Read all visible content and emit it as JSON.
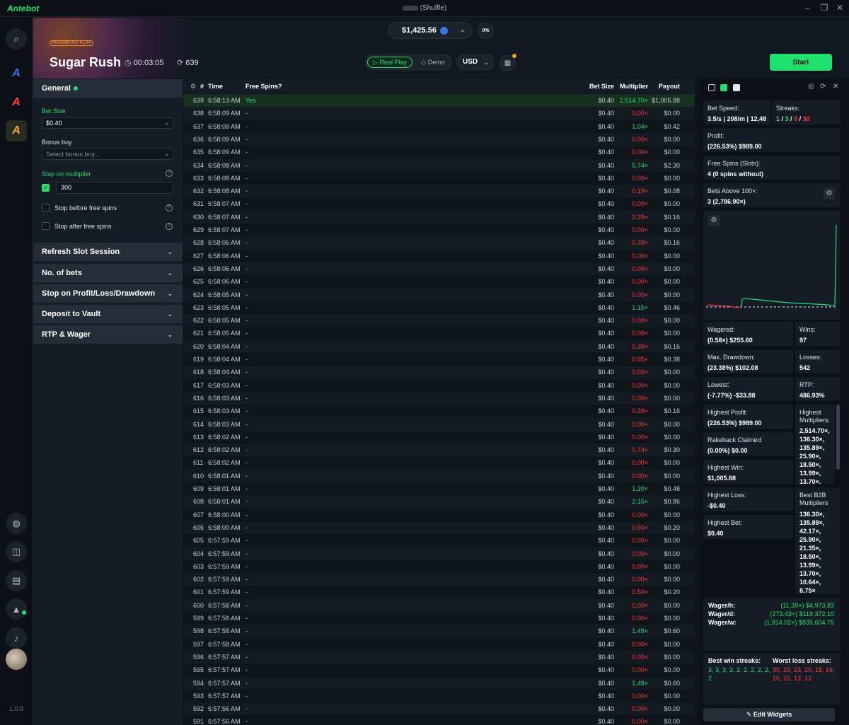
{
  "window": {
    "app": "Antebot",
    "title": "(Shuffle)"
  },
  "nav": {
    "version": "1.0.9"
  },
  "header": {
    "provider": "PRAGMATIC PLAY",
    "game": "Sugar Rush",
    "timer": "00:03:05",
    "spins": "639",
    "balance": "$1,425.56",
    "percent": "0%",
    "real_play": "Real Play",
    "demo": "Demo",
    "currency": "USD",
    "start": "Start"
  },
  "settings": {
    "general": "General",
    "bet_size_label": "Bet Size",
    "bet_size_value": "$0.40",
    "bonus_buy_label": "Bonus buy",
    "bonus_buy_placeholder": "Select bonus buy...",
    "stop_multiplier_label": "Stop on multiplier",
    "stop_multiplier_value": "300",
    "stop_before_free": "Stop before free spins",
    "stop_after_free": "Stop after free spins",
    "sections": [
      "Refresh Slot Session",
      "No. of bets",
      "Stop on Profit/Loss/Drawdown",
      "Deposit to Vault",
      "RTP & Wager"
    ]
  },
  "table": {
    "headers": {
      "id": "#",
      "time": "Time",
      "free_spins": "Free Spins?",
      "bet": "Bet Size",
      "mult": "Multiplier",
      "payout": "Payout"
    },
    "rows": [
      [
        "639",
        "6:58:13 AM",
        "Yes",
        "$0.40",
        "2,514.70×",
        "$1,005.88"
      ],
      [
        "638",
        "6:58:09 AM",
        "-",
        "$0.40",
        "0.00×",
        "$0.00"
      ],
      [
        "637",
        "6:58:09 AM",
        "-",
        "$0.40",
        "1.04×",
        "$0.42"
      ],
      [
        "636",
        "6:58:09 AM",
        "-",
        "$0.40",
        "0.00×",
        "$0.00"
      ],
      [
        "635",
        "6:58:09 AM",
        "-",
        "$0.40",
        "0.00×",
        "$0.00"
      ],
      [
        "634",
        "6:58:08 AM",
        "-",
        "$0.40",
        "5.74×",
        "$2.30"
      ],
      [
        "633",
        "6:58:08 AM",
        "-",
        "$0.40",
        "0.00×",
        "$0.00"
      ],
      [
        "632",
        "6:58:08 AM",
        "-",
        "$0.40",
        "0.19×",
        "$0.08"
      ],
      [
        "631",
        "6:58:07 AM",
        "-",
        "$0.40",
        "0.00×",
        "$0.00"
      ],
      [
        "630",
        "6:58:07 AM",
        "-",
        "$0.40",
        "0.39×",
        "$0.16"
      ],
      [
        "629",
        "6:58:07 AM",
        "-",
        "$0.40",
        "0.00×",
        "$0.00"
      ],
      [
        "628",
        "6:58:06 AM",
        "-",
        "$0.40",
        "0.39×",
        "$0.16"
      ],
      [
        "627",
        "6:58:06 AM",
        "-",
        "$0.40",
        "0.00×",
        "$0.00"
      ],
      [
        "626",
        "6:58:06 AM",
        "-",
        "$0.40",
        "0.00×",
        "$0.00"
      ],
      [
        "625",
        "6:58:06 AM",
        "-",
        "$0.40",
        "0.00×",
        "$0.00"
      ],
      [
        "624",
        "6:58:05 AM",
        "-",
        "$0.40",
        "0.00×",
        "$0.00"
      ],
      [
        "623",
        "6:58:05 AM",
        "-",
        "$0.40",
        "1.15×",
        "$0.46"
      ],
      [
        "622",
        "6:58:05 AM",
        "-",
        "$0.40",
        "0.00×",
        "$0.00"
      ],
      [
        "621",
        "6:58:05 AM",
        "-",
        "$0.40",
        "0.00×",
        "$0.00"
      ],
      [
        "620",
        "6:58:04 AM",
        "-",
        "$0.40",
        "0.39×",
        "$0.16"
      ],
      [
        "619",
        "6:58:04 AM",
        "-",
        "$0.40",
        "0.95×",
        "$0.38"
      ],
      [
        "618",
        "6:58:04 AM",
        "-",
        "$0.40",
        "0.00×",
        "$0.00"
      ],
      [
        "617",
        "6:58:03 AM",
        "-",
        "$0.40",
        "0.00×",
        "$0.00"
      ],
      [
        "616",
        "6:58:03 AM",
        "-",
        "$0.40",
        "0.00×",
        "$0.00"
      ],
      [
        "615",
        "6:58:03 AM",
        "-",
        "$0.40",
        "0.39×",
        "$0.16"
      ],
      [
        "614",
        "6:58:03 AM",
        "-",
        "$0.40",
        "0.00×",
        "$0.00"
      ],
      [
        "613",
        "6:58:02 AM",
        "-",
        "$0.40",
        "0.00×",
        "$0.00"
      ],
      [
        "612",
        "6:58:02 AM",
        "-",
        "$0.40",
        "0.74×",
        "$0.30"
      ],
      [
        "611",
        "6:58:02 AM",
        "-",
        "$0.40",
        "0.00×",
        "$0.00"
      ],
      [
        "610",
        "6:58:01 AM",
        "-",
        "$0.40",
        "0.00×",
        "$0.00"
      ],
      [
        "609",
        "6:58:01 AM",
        "-",
        "$0.40",
        "1.20×",
        "$0.48"
      ],
      [
        "608",
        "6:58:01 AM",
        "-",
        "$0.40",
        "2.15×",
        "$0.86"
      ],
      [
        "607",
        "6:58:00 AM",
        "-",
        "$0.40",
        "0.00×",
        "$0.00"
      ],
      [
        "606",
        "6:58:00 AM",
        "-",
        "$0.40",
        "0.50×",
        "$0.20"
      ],
      [
        "605",
        "6:57:59 AM",
        "-",
        "$0.40",
        "0.00×",
        "$0.00"
      ],
      [
        "604",
        "6:57:59 AM",
        "-",
        "$0.40",
        "0.00×",
        "$0.00"
      ],
      [
        "603",
        "6:57:59 AM",
        "-",
        "$0.40",
        "0.00×",
        "$0.00"
      ],
      [
        "602",
        "6:57:59 AM",
        "-",
        "$0.40",
        "0.00×",
        "$0.00"
      ],
      [
        "601",
        "6:57:59 AM",
        "-",
        "$0.40",
        "0.50×",
        "$0.20"
      ],
      [
        "600",
        "6:57:58 AM",
        "-",
        "$0.40",
        "0.00×",
        "$0.00"
      ],
      [
        "599",
        "6:57:58 AM",
        "-",
        "$0.40",
        "0.00×",
        "$0.00"
      ],
      [
        "598",
        "6:57:58 AM",
        "-",
        "$0.40",
        "1.49×",
        "$0.60"
      ],
      [
        "597",
        "6:57:58 AM",
        "-",
        "$0.40",
        "0.00×",
        "$0.00"
      ],
      [
        "596",
        "6:57:57 AM",
        "-",
        "$0.40",
        "0.00×",
        "$0.00"
      ],
      [
        "595",
        "6:57:57 AM",
        "-",
        "$0.40",
        "0.00×",
        "$0.00"
      ],
      [
        "594",
        "6:57:57 AM",
        "-",
        "$0.40",
        "1.49×",
        "$0.60"
      ],
      [
        "593",
        "6:57:57 AM",
        "-",
        "$0.40",
        "0.00×",
        "$0.00"
      ],
      [
        "592",
        "6:57:56 AM",
        "-",
        "$0.40",
        "0.00×",
        "$0.00"
      ],
      [
        "591",
        "6:57:56 AM",
        "-",
        "$0.40",
        "0.00×",
        "$0.00"
      ]
    ]
  },
  "stats": {
    "bet_speed_t": "Bet Speed:",
    "bet_speed_v": "3.5/s | 208/m | 12,48",
    "streaks_t": "Streaks:",
    "streaks_a": "1",
    "streaks_b": "3",
    "streaks_c": "0",
    "streaks_d": "30",
    "profit_t": "Profit:",
    "profit_v": "(226.53%) $989.00",
    "free_spins_t": "Free Spins (Slots):",
    "free_spins_v": "4 (0 spins without)",
    "bets_above_t": "Bets Above 100×:",
    "bets_above_v": "3 (2,786.90×)",
    "wagered_t": "Wagered:",
    "wagered_v": "(0.58×) $255.60",
    "wins_t": "Wins:",
    "wins_v": "97",
    "maxdd_t": "Max. Drawdown:",
    "maxdd_v": "(23.38%) $102.08",
    "losses_t": "Losses:",
    "losses_v": "542",
    "lowest_t": "Lowest:",
    "lowest_v": "(-7.77%) -$33.88",
    "rtp_t": "RTP:",
    "rtp_v": "486.93%",
    "hprofit_t": "Highest Profit:",
    "hprofit_v": "(226.53%) $989.00",
    "hmult_t": "Highest Multipliers:",
    "hmult_v": [
      "2,514.70×,",
      "136.30×,",
      "135.89×,",
      "25.90×,",
      "18.50×,",
      "13.99×,",
      "13.70×,"
    ],
    "rakeback_t": "Rakeback Claimed:",
    "rakeback_v": "(0.00%) $0.00",
    "hwin_t": "Highest Win:",
    "hwin_v": "$1,005.88",
    "hloss_t": "Highest Loss:",
    "hloss_v": "-$0.40",
    "b2b_t": "Best B2B Multipliers",
    "b2b_v": [
      "136.30×,",
      "135.89×,",
      "42.17×,",
      "25.90×,",
      "21.35×,",
      "18.50×,",
      "13.99×,",
      "13.70×,",
      "10.64×,",
      "8.75×"
    ],
    "hbet_t": "Highest Bet:",
    "hbet_v": "$0.40",
    "wager_h_t": "Wager/h:",
    "wager_h_v": "(11.39×) $4,973.83",
    "wager_d_t": "Wager/d:",
    "wager_d_v": "(273.43×) $119,372.10",
    "wager_w_t": "Wager/w:",
    "wager_w_v": "(1,914.02×) $835,604.75",
    "best_win_t": "Best win streaks:",
    "best_win_v": "3, 3, 3, 3, 2, 2, 2, 2, 2, 2",
    "worst_loss_t": "Worst loss streaks:",
    "worst_loss_v": "30, 23, 23, 20, 18, 16, 16, 15, 13, 13",
    "edit": "Edit Widgets"
  }
}
